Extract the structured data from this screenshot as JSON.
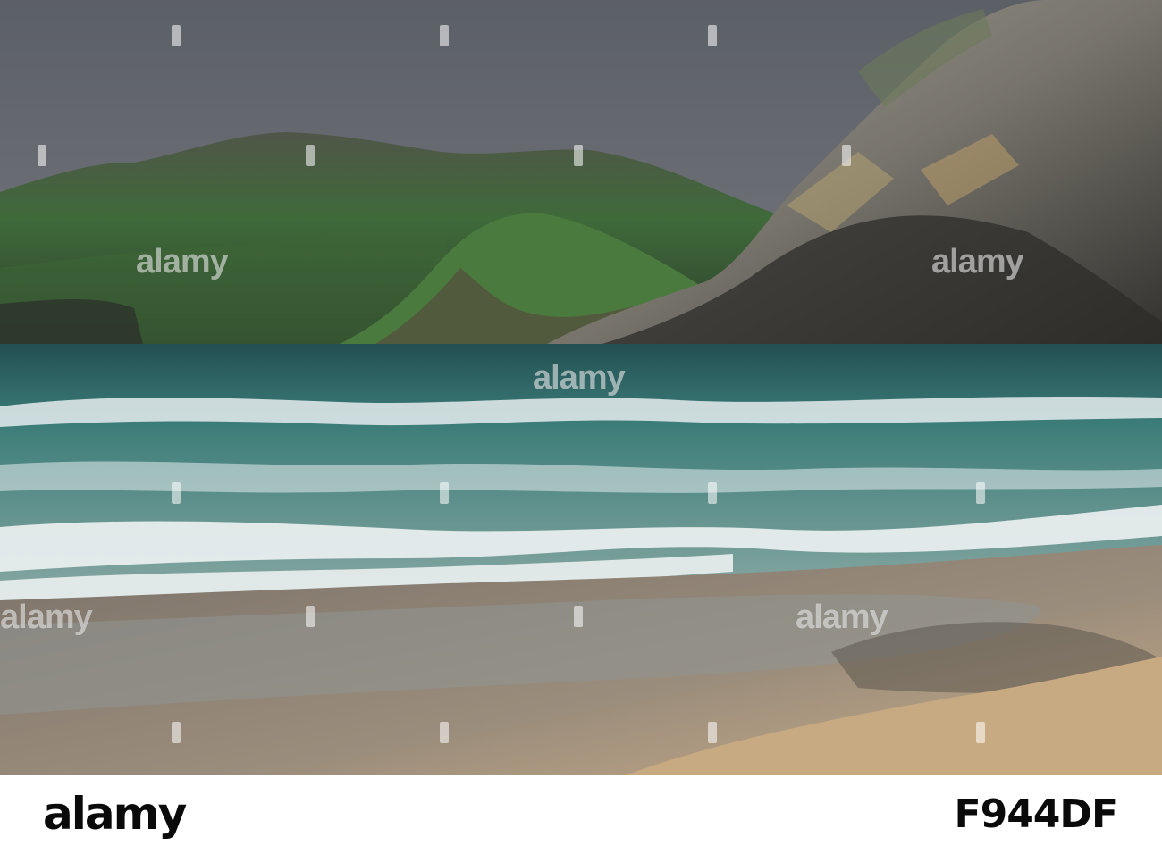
{
  "photo": {
    "subject": "",
    "colors": {
      "sky": "#60646b",
      "far_hill": "#4b4e45",
      "green_slope": "#3f6a3a",
      "headland": "#3a4a35",
      "cliff_light": "#9c9a93",
      "cliff_dark": "#2c2b28",
      "sea": "#2f6d6b",
      "foam": "#e9eef0",
      "wet_sand": "#7d756d",
      "dry_sand": "#c2a784"
    }
  },
  "watermark": {
    "text": "alamy"
  },
  "footer": {
    "logo": "alamy",
    "caption": "",
    "image_id": "F944DF"
  }
}
